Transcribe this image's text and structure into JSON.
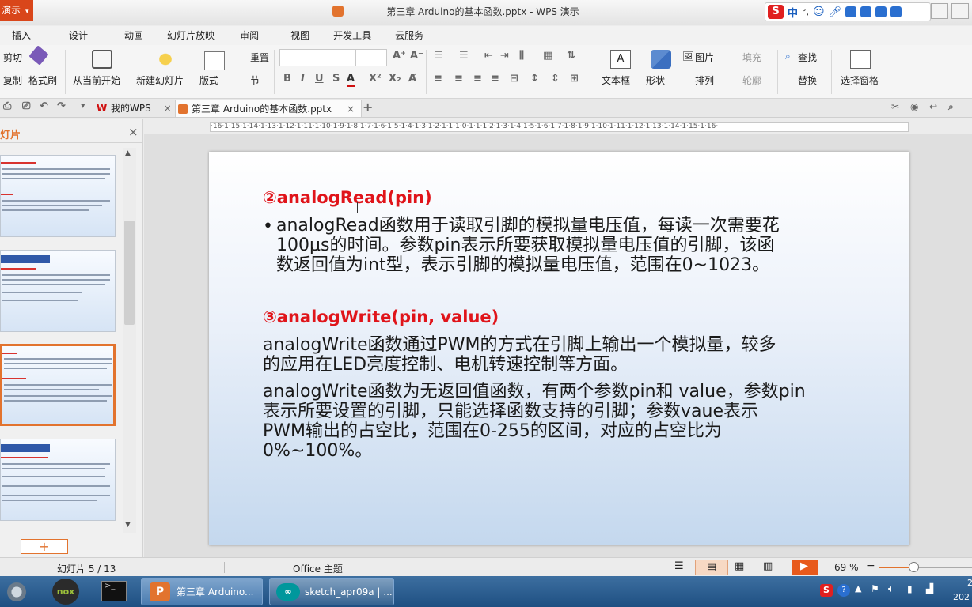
{
  "app": {
    "menu_button": "演示",
    "window_title": "第三章 Arduino的基本函数.pptx - WPS 演示"
  },
  "ime": {
    "lang": "中"
  },
  "menu": [
    "插入",
    "设计",
    "动画",
    "幻灯片放映",
    "审阅",
    "视图",
    "开发工具",
    "云服务"
  ],
  "ribbon": {
    "cut": "剪切",
    "copy": "复制",
    "format_painter": "格式刷",
    "from_current": "从当前开始",
    "new_slide": "新建幻灯片",
    "layout": "版式",
    "reset": "重置",
    "section": "节",
    "textbox": "文本框",
    "shape": "形状",
    "picture": "图片",
    "fill": "填充",
    "arrange": "排列",
    "outline": "轮廓",
    "find": "查找",
    "replace": "替换",
    "select_pane": "选择窗格",
    "font_name": "",
    "font_size": ""
  },
  "tabs": {
    "home_tab": "我的WPS",
    "doc_tab": "第三章 Arduino的基本函数.pptx"
  },
  "side_panel": {
    "title": "灯片"
  },
  "ruler_text": "·16·1·15·1·14·1·13·1·12·1·11·1·10·1·9·1·8·1·7·1·6·1·5·1·4·1·3·1·2·1·1·1·0·1·1·1·2·1·3·1·4·1·5·1·6·1·7·1·8·1·9·1·10·1·11·1·12·1·13·1·14·1·15·1·16·",
  "slide": {
    "heading1": "②analogRead(pin)",
    "bullet1_line1": "analogRead函数用于读取引脚的模拟量电压值，每读一次需要花",
    "bullet1_line2": "100µs的时间。参数pin表示所要获取模拟量电压值的引脚，该函",
    "bullet1_line3": "数返回值为int型，表示引脚的模拟量电压值，范围在0~1023。",
    "heading2": "③analogWrite(pin, value)",
    "para1_line1": "analogWrite函数通过PWM的方式在引脚上输出一个模拟量，较多",
    "para1_line2": "的应用在LED亮度控制、电机转速控制等方面。",
    "para2_line1": "analogWrite函数为无返回值函数，有两个参数pin和 value，参数pin",
    "para2_line2": "表示所要设置的引脚，只能选择函数支持的引脚；参数vaue表示",
    "para2_line3": "PWM输出的占空比，范围在0-255的区间，对应的占空比为",
    "para2_line4": "0%~100%。"
  },
  "status": {
    "slide_counter": "幻灯片 5 / 13",
    "theme": "Office 主题",
    "zoom": "69 %",
    "zoom_fraction": 0.69
  },
  "taskbar": {
    "task1": "第三章 Arduino...",
    "task2": "sketch_apr09a | ...",
    "clock_top": "2",
    "clock_bottom": "202"
  }
}
